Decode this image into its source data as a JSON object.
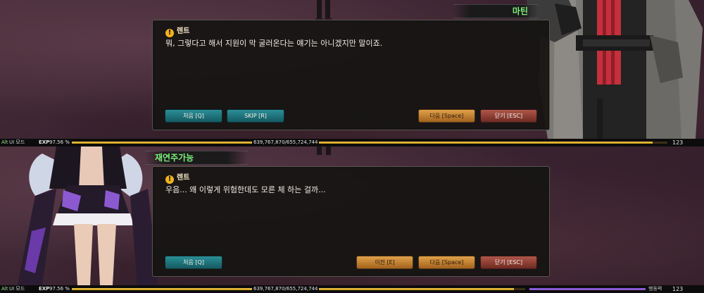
{
  "top": {
    "speaker_tag": "마틴",
    "dialog": {
      "speaker": "렌트",
      "text": "뭐, 그렇다고 해서 지원이 막 굴러온다는 얘기는 아니겠지만 말이죠.",
      "buttons": {
        "first": "처음 [Q]",
        "skip": "SKIP [R]",
        "next": "다음 [Space]",
        "close": "닫기 [ESC]"
      }
    },
    "status": {
      "alt": "Alt",
      "ui_mode": "UI 모드",
      "exp_label": "EXP",
      "exp_value": "97.56 %",
      "exp_progress": 97.56,
      "exp_numbers": "639,767,870/655,724,744",
      "level": "123"
    }
  },
  "bottom": {
    "speaker_tag": "재연주가능",
    "dialog": {
      "speaker": "렌트",
      "text": "우음... 왜 이렇게 위험한데도 모른 체 하는 걸까...",
      "buttons": {
        "first": "처음 [Q]",
        "prev": "이전 [E]",
        "next": "다음 [Space]",
        "close": "닫기 [ESC]"
      }
    },
    "status": {
      "alt": "Alt",
      "ui_mode": "UI 모드",
      "exp_label": "EXP",
      "exp_value": "97.56 %",
      "exp_progress": 97.56,
      "exp_numbers": "639,767,870/655,724,744",
      "action_label": "행동력",
      "action_progress": 100,
      "level": "123"
    }
  },
  "colors": {
    "accent_green": "#7cf07a",
    "warning_icon": "#f2b21c",
    "button_teal": "#2b8f96",
    "button_orange": "#e0a24a",
    "button_red": "#b0574a",
    "exp_bar": "#f1cc4a",
    "action_bar": "#8a5ad6"
  },
  "icons": {
    "speaker_icon": "warning-icon"
  }
}
